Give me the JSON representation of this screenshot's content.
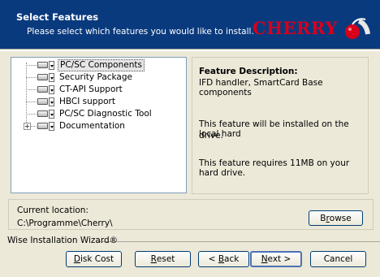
{
  "header": {
    "title": "Select Features",
    "subtitle": "Please select which features you would like to install.",
    "logo_text": "CHERRY",
    "colors": {
      "background": "#0a3a7e",
      "logo": "#d6001c"
    }
  },
  "tree": {
    "items": [
      {
        "label": "PC/SC Components",
        "selected": true,
        "expandable": false,
        "icon": "drive-icon"
      },
      {
        "label": "Security Package",
        "selected": false,
        "expandable": false,
        "icon": "drive-icon"
      },
      {
        "label": "CT-API Support",
        "selected": false,
        "expandable": false,
        "icon": "drive-icon"
      },
      {
        "label": "HBCI support",
        "selected": false,
        "expandable": false,
        "icon": "drive-icon"
      },
      {
        "label": "PC/SC Diagnostic Tool",
        "selected": false,
        "expandable": false,
        "icon": "drive-icon"
      },
      {
        "label": "Documentation",
        "selected": false,
        "expandable": true,
        "icon": "drive-icon"
      }
    ]
  },
  "description": {
    "heading": "Feature Description:",
    "text": "IFD handler, SmartCard Base components",
    "install_line1": "This feature will be installed on the local hard",
    "install_line2": "drive.",
    "requirement": "This feature requires 11MB on your hard drive."
  },
  "location": {
    "label": "Current location:",
    "path": "C:\\Programme\\Cherry\\",
    "browse_prefix": "B",
    "browse_accel": "r",
    "browse_suffix": "owse"
  },
  "footer": {
    "brand": "Wise Installation Wizard®",
    "disk_cost_accel": "D",
    "disk_cost_rest": "isk Cost",
    "reset_accel": "R",
    "reset_rest": "eset",
    "back_prefix": "< ",
    "back_accel": "B",
    "back_rest": "ack",
    "next_accel": "N",
    "next_rest": "ext >",
    "cancel_label": "Cancel"
  }
}
